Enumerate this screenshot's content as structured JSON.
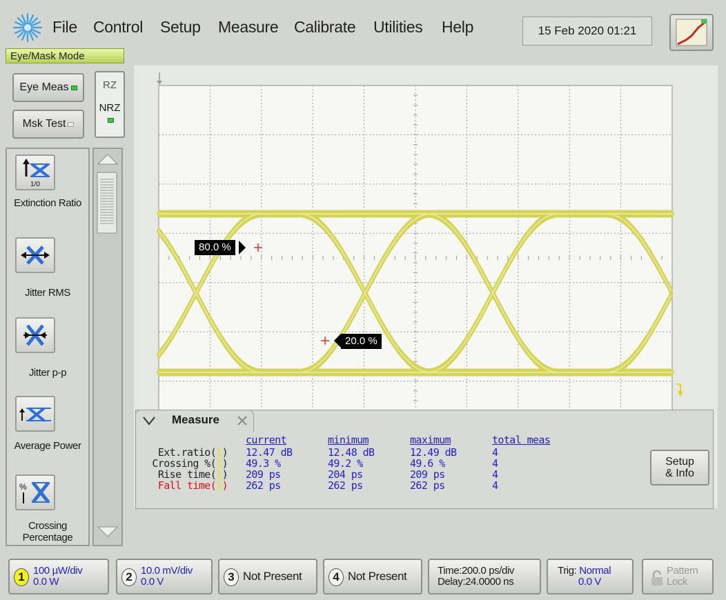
{
  "menu": {
    "items": [
      {
        "label": "File"
      },
      {
        "label": "Control"
      },
      {
        "label": "Setup"
      },
      {
        "label": "Measure"
      },
      {
        "label": "Calibrate"
      },
      {
        "label": "Utilities"
      },
      {
        "label": "Help"
      }
    ],
    "datetime": "15 Feb 2020  01:21",
    "mode_label": "Eye/Mask Mode"
  },
  "left": {
    "eye_meas": "Eye Meas",
    "msk_test": "Msk Test",
    "rz": "RZ",
    "nrz": "NRZ"
  },
  "palette": {
    "items": [
      {
        "label": "Extinction Ratio",
        "icon": "extinction-ratio-icon",
        "icon_text": "1/0"
      },
      {
        "label": "Jitter RMS",
        "icon": "jitter-rms-icon"
      },
      {
        "label": "Jitter p-p",
        "icon": "jitter-pp-icon"
      },
      {
        "label": "Average Power",
        "icon": "average-power-icon"
      },
      {
        "label": "Crossing Percentage",
        "icon": "crossing-percentage-icon",
        "icon_text": "%"
      }
    ]
  },
  "screen": {
    "marker_80": "80.0 %",
    "marker_20": "20.0 %",
    "trace_color": "#d8d860"
  },
  "measure": {
    "tab_label": "Measure",
    "headers": {
      "current": "current",
      "minimum": "minimum",
      "maximum": "maximum",
      "total": "total meas"
    },
    "rows": [
      {
        "name": "Ext.ratio(",
        "ch": "1",
        "current": "12.47 dB",
        "minimum": "12.48 dB",
        "maximum": "12.49 dB",
        "total": "4"
      },
      {
        "name": "Crossing %(",
        "ch": "1",
        "current": "49.3 %",
        "minimum": "49.2 %",
        "maximum": "49.6 %",
        "total": "4"
      },
      {
        "name": "Rise time(",
        "ch": "1",
        "current": "209 ps",
        "minimum": "204 ps",
        "maximum": "209 ps",
        "total": "4"
      },
      {
        "name": "Fall time(",
        "ch": "1",
        "current": "262 ps",
        "minimum": "262 ps",
        "maximum": "262 ps",
        "total": "4"
      }
    ],
    "setup_info_1": "Setup",
    "setup_info_2": "& Info"
  },
  "status": {
    "ch1": {
      "num": "1",
      "line1": "100 µW/div",
      "line2": "0.0 W"
    },
    "ch2": {
      "num": "2",
      "line1": "10.0 mV/div",
      "line2": "0.0 V"
    },
    "ch3": {
      "num": "3",
      "label": "Not Present"
    },
    "ch4": {
      "num": "4",
      "label": "Not Present"
    },
    "time": {
      "line1": "Time:200.0 ps/div",
      "line2": "Delay:24.0000 ns"
    },
    "trig": {
      "prefix": "Trig:",
      "mode": "Normal",
      "level": "0.0 V"
    },
    "pattern": {
      "line1": "Pattern",
      "line2": "Lock"
    }
  }
}
